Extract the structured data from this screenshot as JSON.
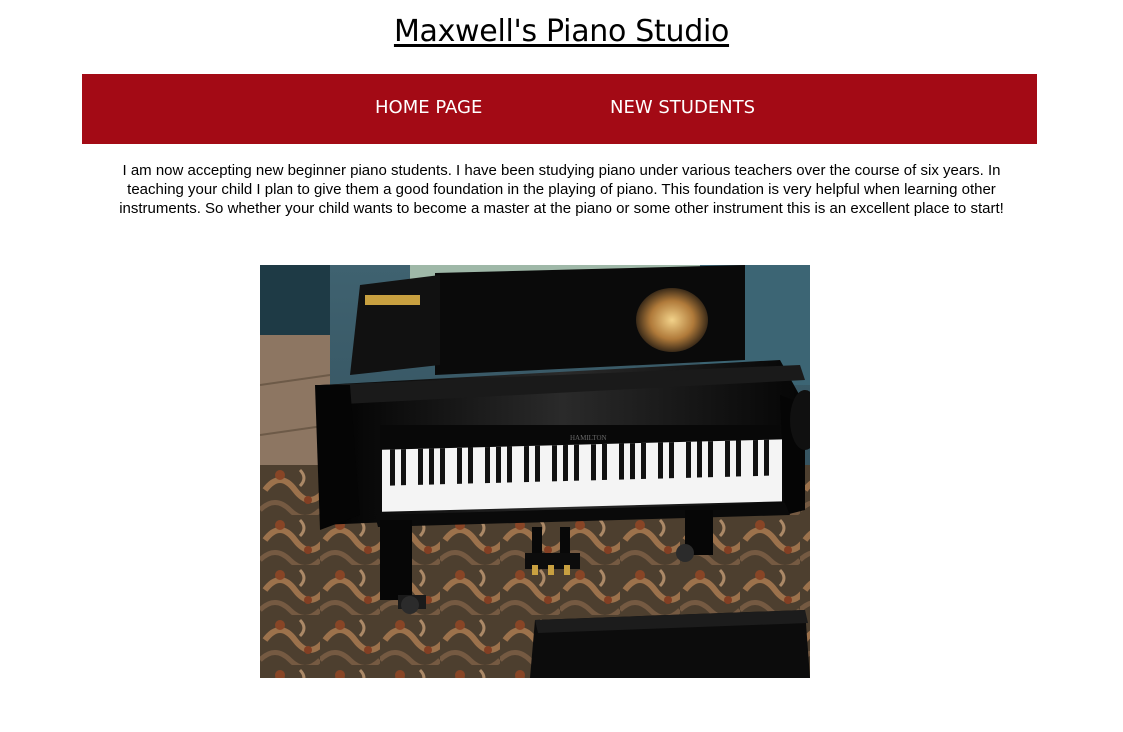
{
  "header": {
    "title": "Maxwell's Piano Studio"
  },
  "nav": {
    "items": [
      {
        "label": "HOME PAGE"
      },
      {
        "label": "NEW STUDENTS"
      }
    ],
    "background_color": "#a30a15"
  },
  "main": {
    "intro_text": "I am now accepting new beginner piano students. I have been studying piano under various teachers over the course of six years. In teaching your child I plan to give them a good foundation in the playing of piano. This foundation is very helpful when learning other instruments. So whether your child wants to become a master at the piano or some other instrument this is an excellent place to start!"
  }
}
